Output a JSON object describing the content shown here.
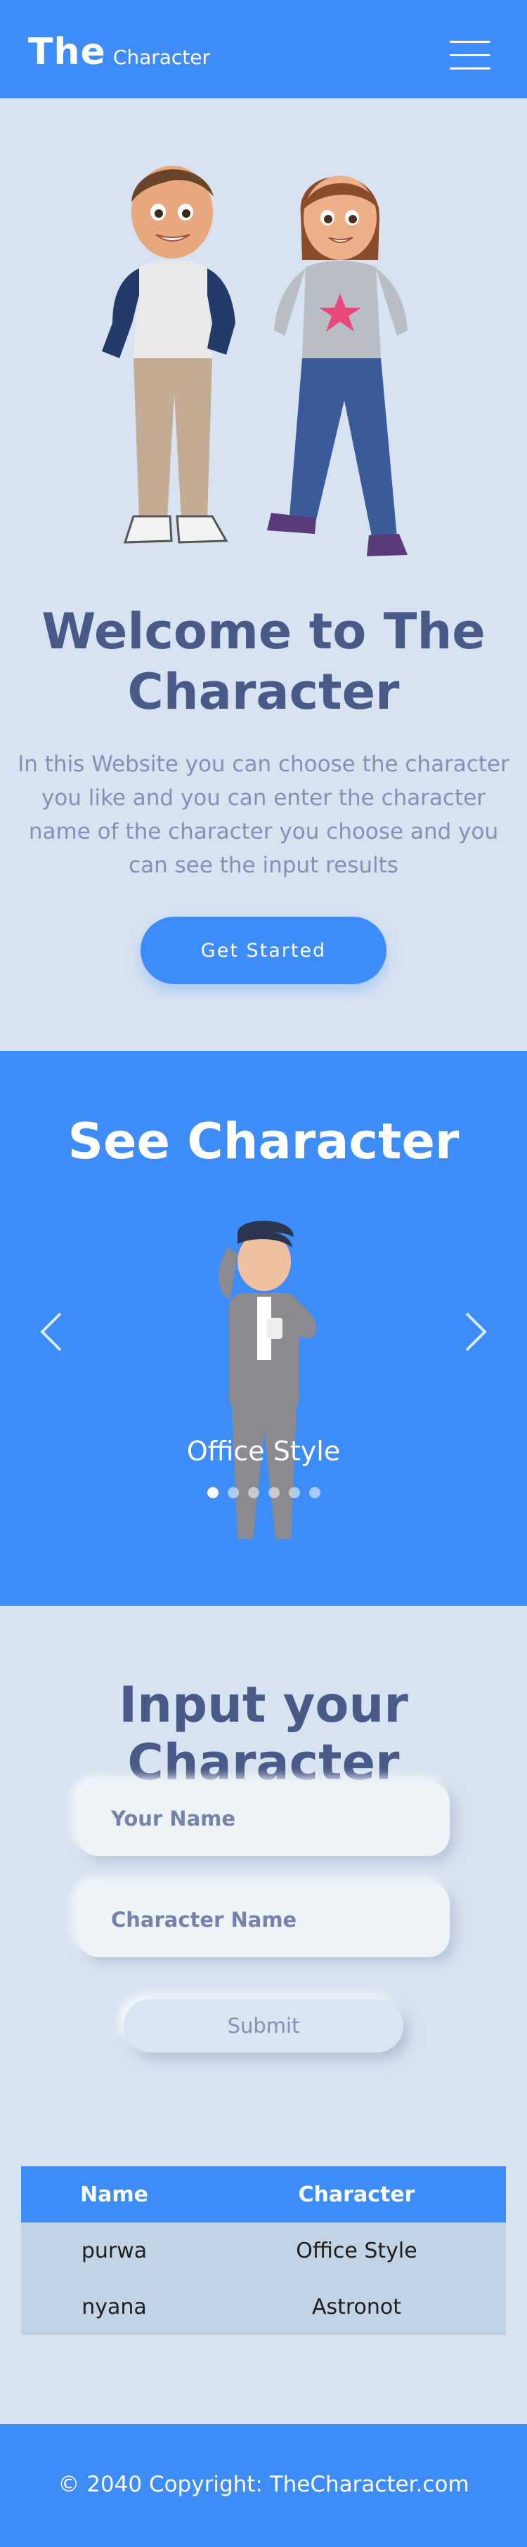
{
  "navbar": {
    "brand_main": "The",
    "brand_sub": "Character",
    "menu_icon": "hamburger-menu-icon"
  },
  "hero": {
    "title": "Welcome to The Character",
    "text": "In this Website you can choose the character you like and you can enter the character name of the character you choose and you can see the input results",
    "button_label": "Get Started"
  },
  "see_character": {
    "title": "See Character",
    "slide_caption": "Office Style",
    "prev_icon": "chevron-left-icon",
    "next_icon": "chevron-right-icon",
    "slide_count": 6,
    "active_slide": 1
  },
  "input_section": {
    "title": "Input your Character",
    "name_placeholder": "Your Name",
    "character_placeholder": "Character Name",
    "submit_label": "Submit"
  },
  "results_table": {
    "headers": [
      "Name",
      "Character"
    ],
    "rows": [
      [
        "purwa",
        "Office Style"
      ],
      [
        "nyana",
        "Astronot"
      ]
    ]
  },
  "footer": {
    "copyright": "© 2040 Copyright: TheCharacter.com"
  },
  "colors": {
    "primary": "#3d8cf7",
    "background": "#d8e3f1",
    "heading": "#4a5a88",
    "muted_text": "#8590b5",
    "table_row": "#c2d3e6"
  }
}
